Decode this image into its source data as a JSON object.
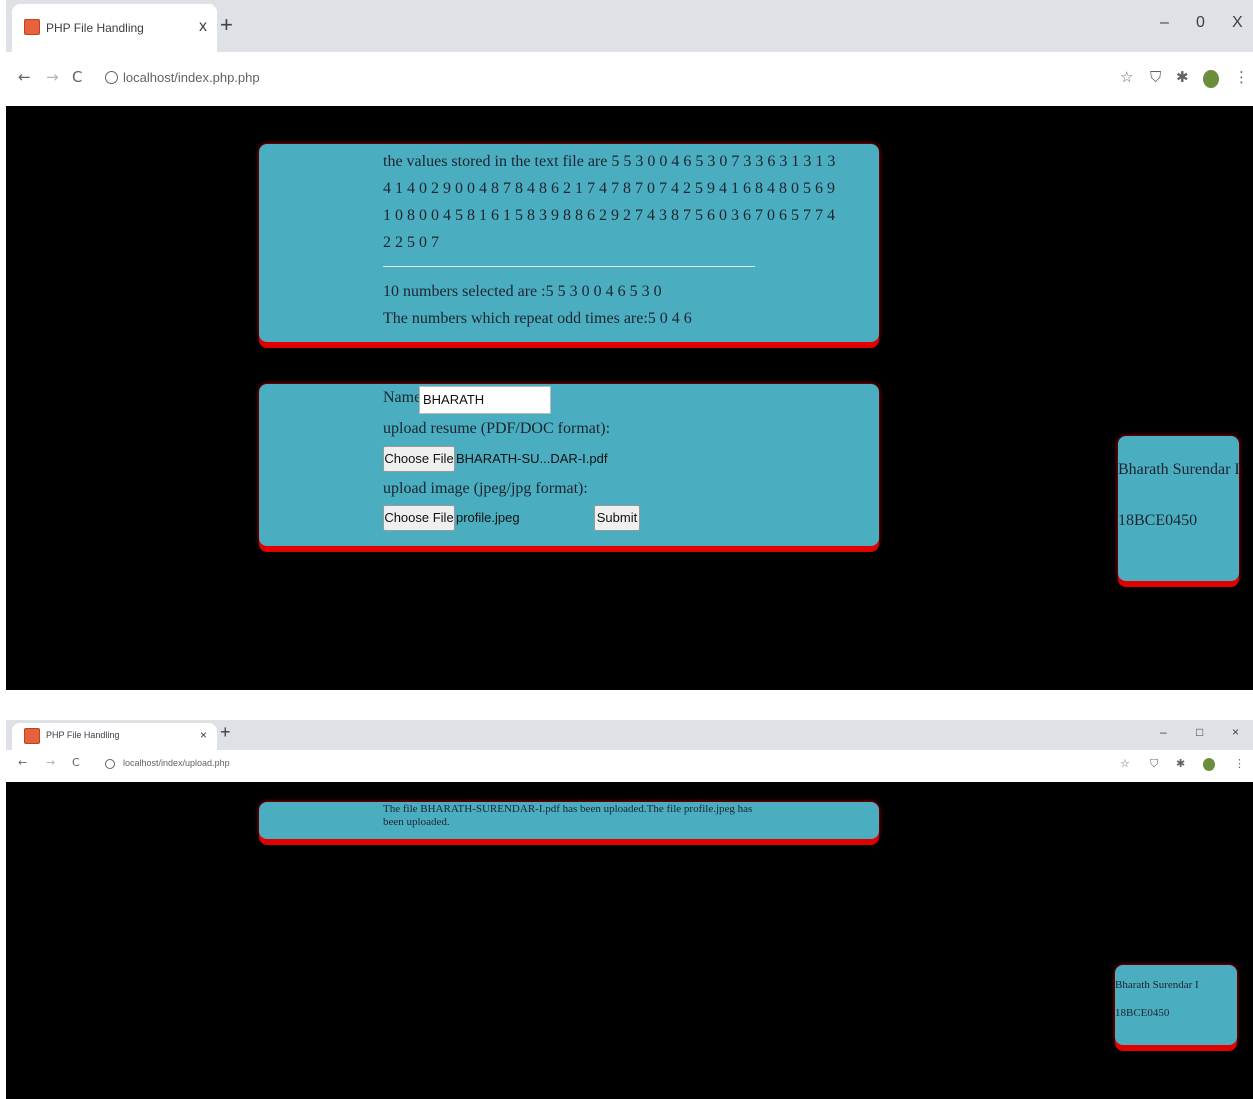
{
  "window1": {
    "tab_title": "PHP File Handling",
    "tab_close": "x",
    "new_tab": "+",
    "minimize": "–",
    "maximize": "0",
    "close": "X",
    "nav": {
      "back": "←",
      "forward": "→",
      "reload": "C"
    },
    "url": "localhost/index.php.php",
    "card1": {
      "line1": "the values stored in the text file are 5 5 3 0 0 4 6 5 3 0 7 3 3 6 3 1 3 1 3",
      "line2": "4 1 4 0 2 9 0 0 4 8 7 8 4 8 6 2 1 7 4 7 8 7 0 7 4 2 5 9 4 1 6 8 4 8 0 5 6 9",
      "line3": "1 0 8 0 0 4 5 8 1 6 1 5 8 3 9 8 8 6 2 9 2 7 4 3 8 7 5 6 0 3 6 7 0 6 5 7 7 4",
      "line4": "2 2 5 0 7",
      "selected": "10 numbers selected are :5 5 3 0 0 4 6 5 3 0",
      "odd": "The numbers which repeat odd times are:5 0 4 6"
    },
    "form": {
      "name_label": "Name:",
      "name_value": "BHARATH",
      "resume_label": "upload resume (PDF/DOC format):",
      "choose_file_label": "Choose File",
      "resume_file": "BHARATH-SU...DAR-I.pdf",
      "image_label": "upload image (jpeg/jpg format):",
      "image_file": "profile.jpeg",
      "submit_label": "Submit"
    },
    "side": {
      "name": "Bharath Surendar I",
      "id": "18BCE0450"
    }
  },
  "window2": {
    "tab_title": "PHP File Handling",
    "tab_close": "×",
    "new_tab": "+",
    "minimize": "–",
    "maximize": "□",
    "close": "×",
    "nav": {
      "back": "←",
      "forward": "→",
      "reload": "C"
    },
    "url": "localhost/index/upload.php",
    "message": "The file BHARATH-SURENDAR-I.pdf has been uploaded.The file profile.jpeg has been uploaded.",
    "side": {
      "name": "Bharath Surendar I",
      "id": "18BCE0450"
    }
  },
  "colors": {
    "card": "#4aaec0",
    "border": "#e10000",
    "background": "#000000"
  }
}
